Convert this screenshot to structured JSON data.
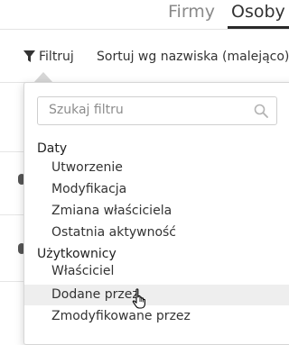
{
  "tabs": [
    {
      "label": "Firmy",
      "active": false
    },
    {
      "label": "Osoby",
      "active": true
    }
  ],
  "toolbar": {
    "filter_label": "Filtruj",
    "sort_label": "Sortuj wg nazwiska (malejąco)"
  },
  "filter_dropdown": {
    "search_placeholder": "Szukaj filtru",
    "search_value": "",
    "groups": [
      {
        "title": "Daty",
        "items": [
          "Utworzenie",
          "Modyfikacja",
          "Zmiana właściciela",
          "Ostatnia aktywność"
        ]
      },
      {
        "title": "Użytkownicy",
        "items": [
          "Właściciel",
          "Dodane przez",
          "Zmodyfikowane przez"
        ]
      }
    ],
    "hovered_item": "Dodane przez"
  },
  "colors": {
    "active_tab_underline": "#2a2a2a",
    "inactive_tab_text": "#8a8a8a",
    "hover_background": "#eeeeee"
  },
  "icons": {
    "filter": "funnel-icon",
    "sort": "caret-down-icon",
    "search": "magnifier-icon",
    "cursor": "hand-pointer-cursor"
  }
}
